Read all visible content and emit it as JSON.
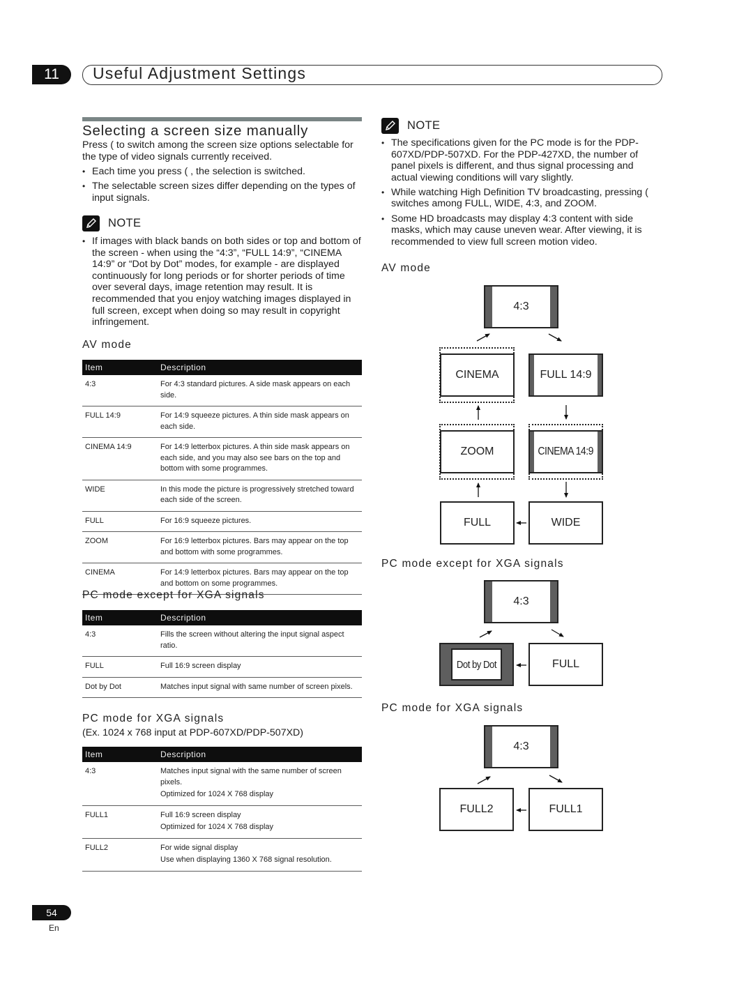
{
  "header": {
    "chapter_number": "11",
    "chapter_title": "Useful Adjustment Settings"
  },
  "section": {
    "title": "Selecting a screen size manually",
    "intro": "Press (    to switch among the screen size options selectable for the type of video signals currently received.",
    "bullets": [
      "Each time you press (   , the selection is switched.",
      "The selectable screen sizes differ depending on the types of input signals."
    ]
  },
  "note_left": {
    "label": "NOTE",
    "bullets": [
      "If images with black bands on both sides or top and bottom of the screen - when using the “4:3”, “FULL 14:9”, “CINEMA 14:9” or “Dot by Dot” modes, for example - are displayed continuously for long periods or for shorter periods of time over several days, image retention may result. It is recommended that you enjoy watching images displayed in full screen, except when doing so may result in copyright infringement."
    ]
  },
  "av_mode_table": {
    "heading": "AV mode",
    "columns": [
      "Item",
      "Description"
    ],
    "rows": [
      {
        "item": "4:3",
        "description": "For 4:3 standard pictures. A side mask appears on each side."
      },
      {
        "item": "FULL 14:9",
        "description": "For 14:9 squeeze pictures. A thin side mask appears on each side."
      },
      {
        "item": "CINEMA 14:9",
        "description": "For 14:9 letterbox pictures. A thin side mask appears on each side, and you may also see bars on the top and bottom with some programmes."
      },
      {
        "item": "WIDE",
        "description": "In this mode the picture is progressively stretched toward each side of the screen."
      },
      {
        "item": "FULL",
        "description": "For 16:9 squeeze pictures."
      },
      {
        "item": "ZOOM",
        "description": "For 16:9 letterbox pictures. Bars may appear on the top and bottom with some programmes."
      },
      {
        "item": "CINEMA",
        "description": "For 14:9 letterbox pictures. Bars may appear on the top and bottom on some programmes."
      }
    ]
  },
  "pc_table": {
    "heading": "PC mode except for XGA signals",
    "columns": [
      "Item",
      "Description"
    ],
    "rows": [
      {
        "item": "4:3",
        "description": "Fills the screen without altering the input signal aspect ratio."
      },
      {
        "item": "FULL",
        "description": "Full 16:9 screen display"
      },
      {
        "item": "Dot by Dot",
        "description": "Matches input signal with same number of screen pixels."
      }
    ]
  },
  "xga_table": {
    "heading": "PC mode for XGA signals",
    "subheading": "(Ex. 1024 x 768 input at PDP-607XD/PDP-507XD)",
    "columns": [
      "Item",
      "Description"
    ],
    "rows": [
      {
        "item": "4:3",
        "description": "Matches input signal with the same number of screen pixels.",
        "extra": "Optimized for 1024 X 768 display"
      },
      {
        "item": "FULL1",
        "description": "Full 16:9 screen display",
        "extra": "Optimized for 1024 X 768 display"
      },
      {
        "item": "FULL2",
        "description": "For wide signal display",
        "extra": "Use when displaying 1360 X 768 signal resolution."
      }
    ]
  },
  "note_right": {
    "label": "NOTE",
    "bullets": [
      "The specifications given for the PC mode is for the PDP-607XD/PDP-507XD. For the PDP-427XD, the number of panel pixels is different, and thus signal processing and actual viewing conditions will vary slightly.",
      "While watching High Definition TV broadcasting, pressing (    switches among FULL, WIDE, 4:3, and ZOOM.",
      "Some HD broadcasts may display 4:3 content with side masks, which may cause uneven wear.  After viewing, it is recommended to view full screen motion video."
    ]
  },
  "diagram_av": {
    "heading": "AV mode",
    "modes": [
      "4:3",
      "FULL 14:9",
      "CINEMA 14:9",
      "WIDE",
      "FULL",
      "ZOOM",
      "CINEMA"
    ]
  },
  "diagram_pc": {
    "heading": "PC mode except for XGA signals",
    "modes": [
      "4:3",
      "FULL",
      "Dot by Dot"
    ]
  },
  "diagram_xga": {
    "heading": "PC mode for XGA signals",
    "modes": [
      "4:3",
      "FULL1",
      "FULL2"
    ]
  },
  "footer": {
    "page_number": "54",
    "language": "En"
  }
}
